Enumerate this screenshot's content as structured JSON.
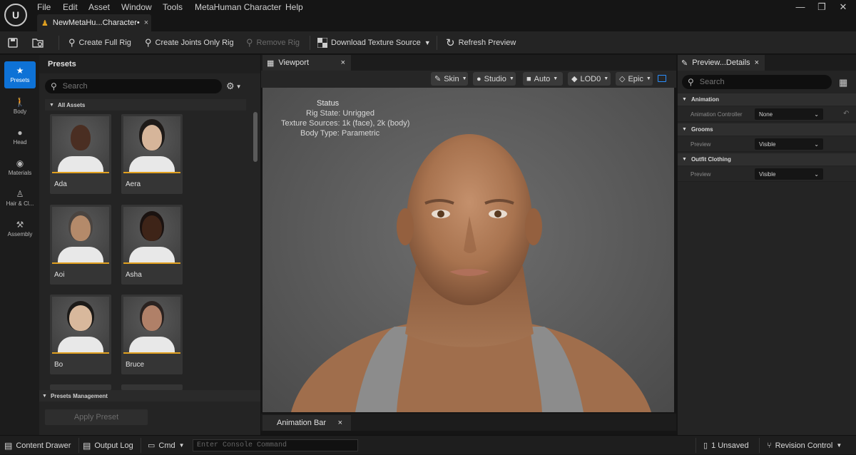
{
  "menu": [
    "File",
    "Edit",
    "Asset",
    "Window",
    "Tools",
    "MetaHuman Character",
    "Help"
  ],
  "logo_text": "U",
  "document_tab": {
    "label": "NewMetaHu...Character•",
    "close": "×"
  },
  "window_controls": {
    "minimize": "—",
    "restore": "❐",
    "close": "✕"
  },
  "toolbar": {
    "create_full_rig": "Create Full Rig",
    "create_joints_only_rig": "Create Joints Only Rig",
    "remove_rig": "Remove Rig",
    "download_texture_source": "Download Texture Source",
    "refresh_preview": "Refresh Preview"
  },
  "sidebar": {
    "items": [
      {
        "label": "Presets",
        "icon": "star-icon",
        "active": true
      },
      {
        "label": "Body",
        "icon": "person-icon"
      },
      {
        "label": "Head",
        "icon": "head-icon"
      },
      {
        "label": "Materials",
        "icon": "palette-icon"
      },
      {
        "label": "Hair & Cl...",
        "icon": "hanger-icon"
      },
      {
        "label": "Assembly",
        "icon": "hammer-icon"
      }
    ]
  },
  "presets": {
    "title": "Presets",
    "search_placeholder": "Search",
    "all_assets": "All Assets",
    "items": [
      "Ada",
      "Aera",
      "Aoi",
      "Asha",
      "Bo",
      "Bruce"
    ],
    "management": "Presets Management",
    "apply_button": "Apply Preset"
  },
  "viewport": {
    "tab": "Viewport",
    "close": "×",
    "buttons": [
      "Skin",
      "Studio",
      "Auto",
      "LOD0",
      "Epic"
    ],
    "status": {
      "title": "Status",
      "lines": [
        "Rig State: Unrigged",
        "Texture Sources: 1k (face), 2k (body)",
        "Body Type: Parametric"
      ]
    }
  },
  "animation_bar": {
    "tab": "Animation Bar",
    "close": "×"
  },
  "details": {
    "tab": "Preview...Details",
    "close": "×",
    "search_placeholder": "Search",
    "sections": [
      {
        "title": "Animation",
        "rows": [
          {
            "label": "Animation Controller",
            "value": "None"
          }
        ]
      },
      {
        "title": "Grooms",
        "rows": [
          {
            "label": "Preview",
            "value": "Visible"
          }
        ]
      },
      {
        "title": "Outfit Clothing",
        "rows": [
          {
            "label": "Preview",
            "value": "Visible"
          }
        ]
      }
    ]
  },
  "statusbar": {
    "content_drawer": "Content Drawer",
    "output_log": "Output Log",
    "cmd": "Cmd",
    "console_placeholder": "Enter Console Command",
    "unsaved": "1 Unsaved",
    "revision_control": "Revision Control"
  },
  "colors": {
    "accent": "#0e72d6",
    "thumbnail_bar": "#e0a020",
    "panel": "#242424",
    "background": "#151515"
  }
}
